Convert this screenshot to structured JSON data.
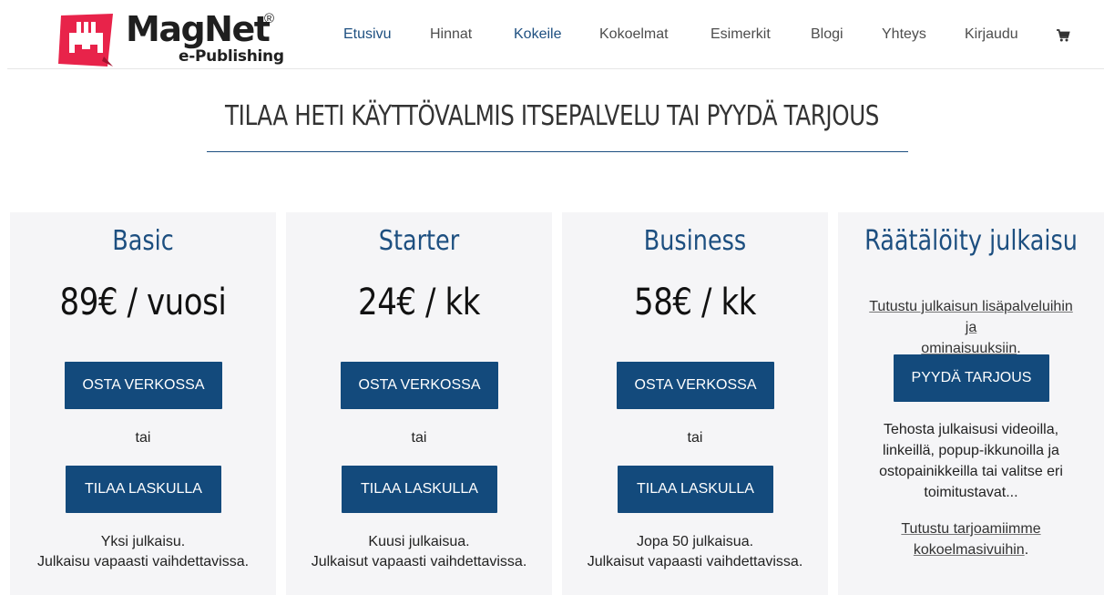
{
  "brand": {
    "name": "MagNet",
    "reg": "®",
    "sub": "e-Publishing",
    "color": "#e8234a"
  },
  "nav": {
    "items": [
      "Etusivu",
      "Hinnat",
      "Kokeile",
      "Kokoelmat",
      "Esimerkit",
      "Blogi",
      "Yhteys",
      "Kirjaudu"
    ],
    "cart_icon": "cart-icon"
  },
  "title": "TILAA HETI KÄYTTÖVALMIS ITSEPALVELU TAI PYYDÄ TARJOUS",
  "colors": {
    "accent": "#1d4f80",
    "button": "#134a7c",
    "card_bg": "#f5f5f7"
  },
  "plans": [
    {
      "name": "Basic",
      "price": "89€ / vuosi",
      "buy": "OSTA VERKOSSA",
      "or": "tai",
      "invoice": "TILAA LASKULLA",
      "desc1": "Yksi julkaisu.",
      "desc2": "Julkaisu vapaasti vaihdettavissa."
    },
    {
      "name": "Starter",
      "price": "24€ / kk",
      "buy": "OSTA VERKOSSA",
      "or": "tai",
      "invoice": "TILAA LASKULLA",
      "desc1": "Kuusi julkaisua.",
      "desc2": "Julkaisut vapaasti vaihdettavissa."
    },
    {
      "name": "Business",
      "price": "58€ / kk",
      "buy": "OSTA VERKOSSA",
      "or": "tai",
      "invoice": "TILAA LASKULLA",
      "desc1": "Jopa 50 julkaisua.",
      "desc2": "Julkaisut vapaasti vaihdettavissa."
    }
  ],
  "custom": {
    "name": "Räätälöity julkaisu",
    "link1_a": "Tutustu julkaisun lisäpalveluihin ja",
    "link1_b": "ominaisuuksiin",
    "link1_end": ".",
    "button": "PYYDÄ TARJOUS",
    "text": "Tehosta julkaisusi videoilla, linkeillä, popup-ikkunoilla ja ostopainikkeilla tai valitse eri toimitustavat...",
    "link2_a": "Tutustu tarjoamiimme",
    "link2_b": "kokoelmasivuihin",
    "link2_end": "."
  }
}
